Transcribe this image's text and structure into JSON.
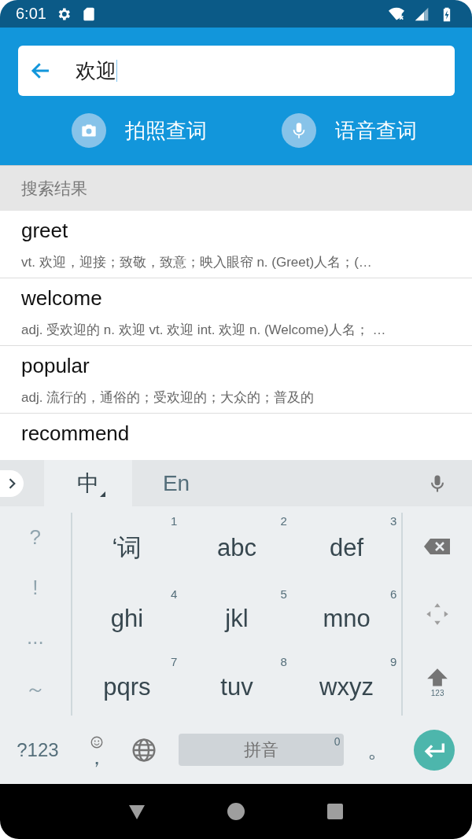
{
  "status_bar": {
    "time": "6:01"
  },
  "search": {
    "value": "欢迎"
  },
  "actions": [
    {
      "kind": "camera",
      "label": "拍照查词"
    },
    {
      "kind": "voice",
      "label": "语音查词"
    }
  ],
  "results": {
    "title": "搜索结果",
    "items": [
      {
        "word": "greet",
        "definition": "vt. 欢迎，迎接；致敬，致意；映入眼帘 n. (Greet)人名；(…"
      },
      {
        "word": "welcome",
        "definition": "adj. 受欢迎的 n. 欢迎 vt. 欢迎 int. 欢迎 n. (Welcome)人名； …"
      },
      {
        "word": "popular",
        "definition": "adj. 流行的，通俗的；受欢迎的；大众的；普及的"
      },
      {
        "word": "recommend"
      }
    ]
  },
  "keyboard": {
    "tabs": [
      {
        "label": "中",
        "selected": true
      },
      {
        "label": "En",
        "selected": false
      }
    ],
    "symbols": [
      "?",
      "!",
      "...",
      "～"
    ],
    "keys": [
      {
        "label": "‘词",
        "number": "1"
      },
      {
        "label": "abc",
        "number": "2"
      },
      {
        "label": "def",
        "number": "3"
      },
      {
        "label": "ghi",
        "number": "4"
      },
      {
        "label": "jkl",
        "number": "5"
      },
      {
        "label": "mno",
        "number": "6"
      },
      {
        "label": "pqrs",
        "number": "7"
      },
      {
        "label": "tuv",
        "number": "8"
      },
      {
        "label": "wxyz",
        "number": "9"
      }
    ],
    "shift_label": "123",
    "symbols_key": "?123",
    "comma_key": "，",
    "space": {
      "label": "拼音",
      "number": "0"
    },
    "period_key": "。"
  }
}
